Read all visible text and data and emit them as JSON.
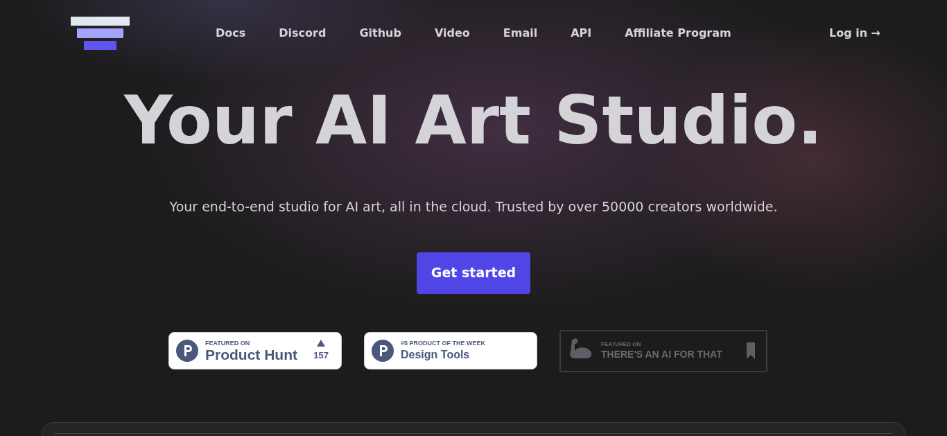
{
  "nav": {
    "links": [
      {
        "label": "Docs"
      },
      {
        "label": "Discord"
      },
      {
        "label": "Github"
      },
      {
        "label": "Video"
      },
      {
        "label": "Email"
      },
      {
        "label": "API"
      },
      {
        "label": "Affiliate Program"
      }
    ],
    "login": "Log in →"
  },
  "hero": {
    "title": "Your AI Art Studio.",
    "subtitle": "Your end-to-end studio for AI art, all in the cloud. Trusted by over 50000 creators worldwide.",
    "cta": "Get started"
  },
  "badges": [
    {
      "kind": "producthunt",
      "caption": "FEATURED ON",
      "name": "Product Hunt",
      "votes": "157"
    },
    {
      "kind": "producthunt",
      "caption": "#5 PRODUCT OF THE WEEK",
      "name": "Design Tools"
    },
    {
      "kind": "aiforthat",
      "caption": "FEATURED ON",
      "name": "THERE'S AN AI FOR THAT"
    }
  ]
}
